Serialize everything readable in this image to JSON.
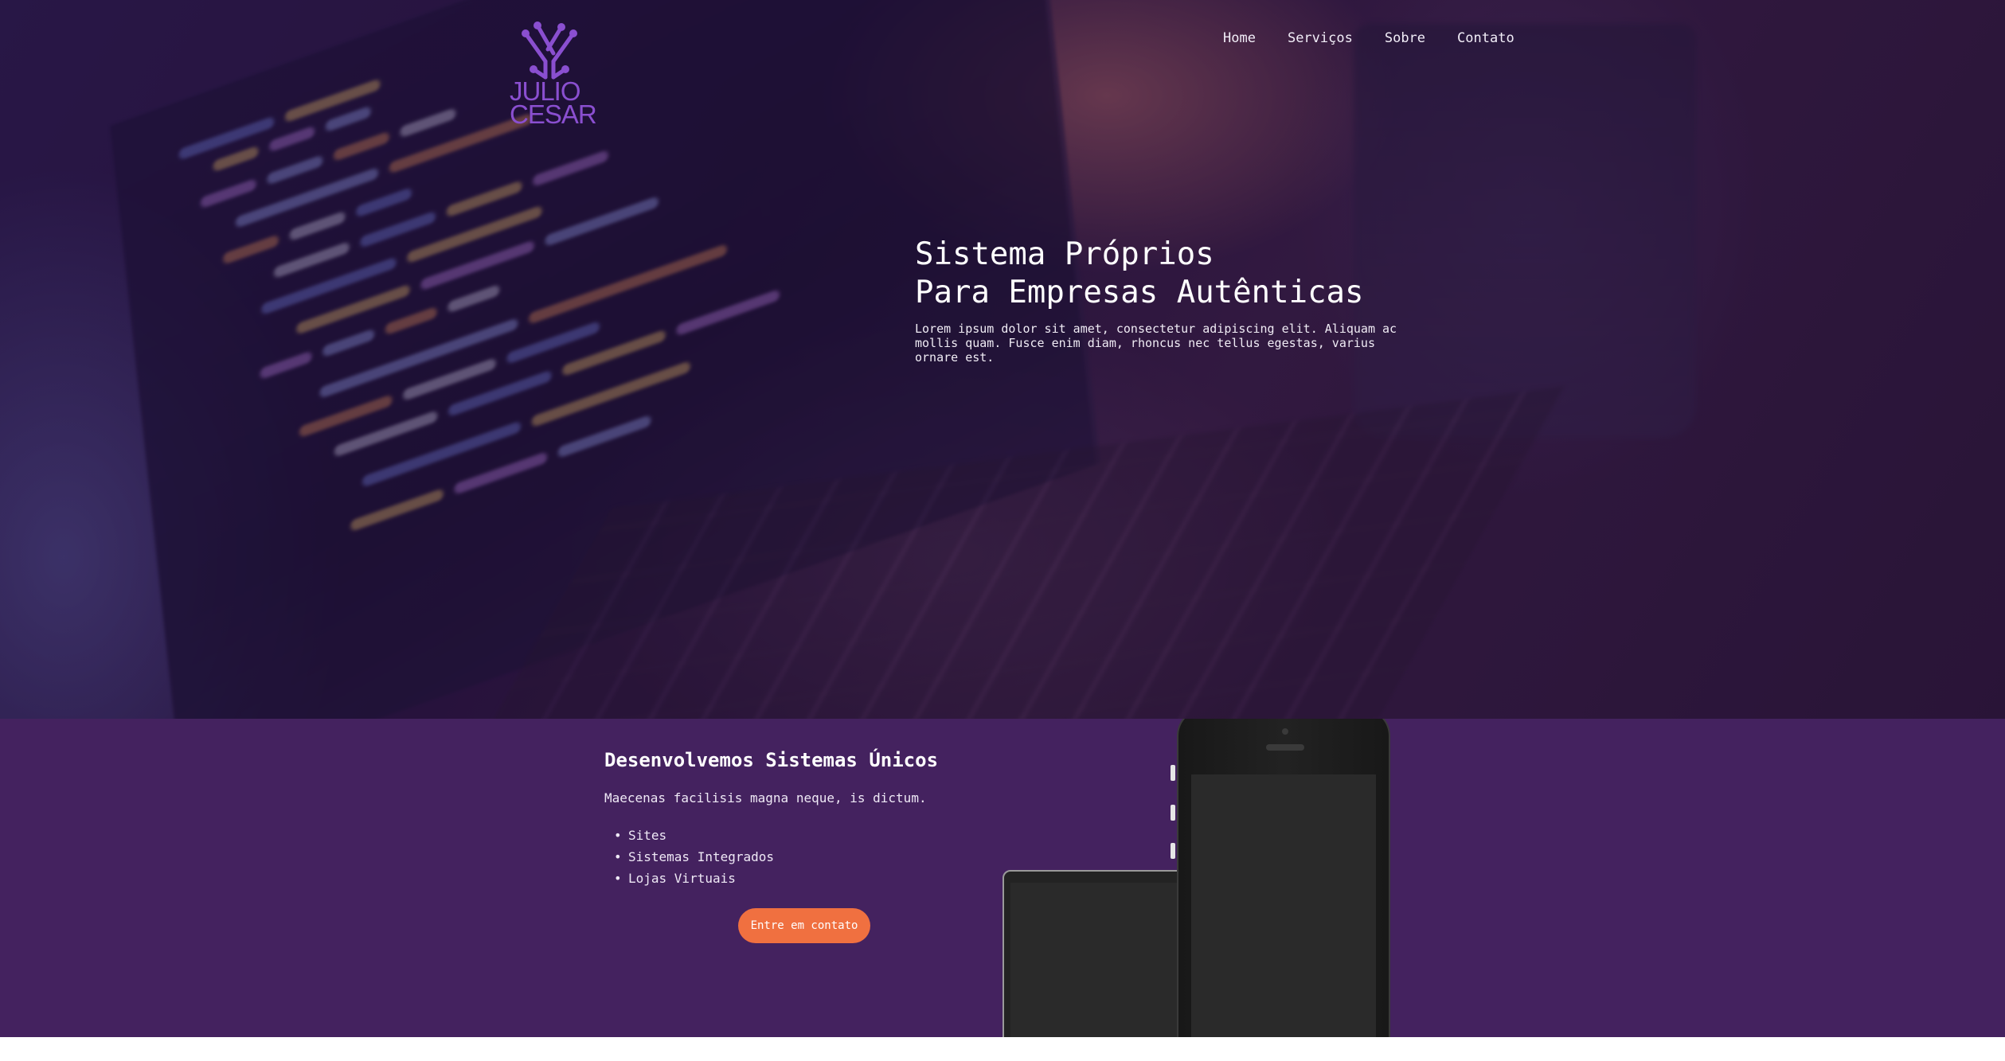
{
  "brand": {
    "logo_text": "JULIO\nCESAR",
    "accent_color": "#8a4fd0"
  },
  "nav": {
    "items": [
      "Home",
      "Serviços",
      "Sobre",
      "Contato"
    ]
  },
  "hero": {
    "title_line1": "Sistema Próprios",
    "title_line2": "Para Empresas Autênticas",
    "description": "Lorem ipsum dolor sit amet, consectetur adipiscing elit. Aliquam ac mollis quam. Fusce enim diam, rhoncus nec tellus egestas, varius ornare est."
  },
  "services": {
    "title": "Desenvolvemos Sistemas Únicos",
    "subtitle": "Maecenas facilisis magna neque, is dictum.",
    "list": [
      "Sites",
      "Sistemas Integrados",
      "Lojas Virtuais"
    ],
    "cta_label": "Entre em contato",
    "background_color": "#44225f",
    "cta_color": "#f07040"
  },
  "icons": {
    "logo": "circuit-logo-icon",
    "tablet": "tablet-device-icon",
    "phone": "smartphone-device-icon"
  }
}
